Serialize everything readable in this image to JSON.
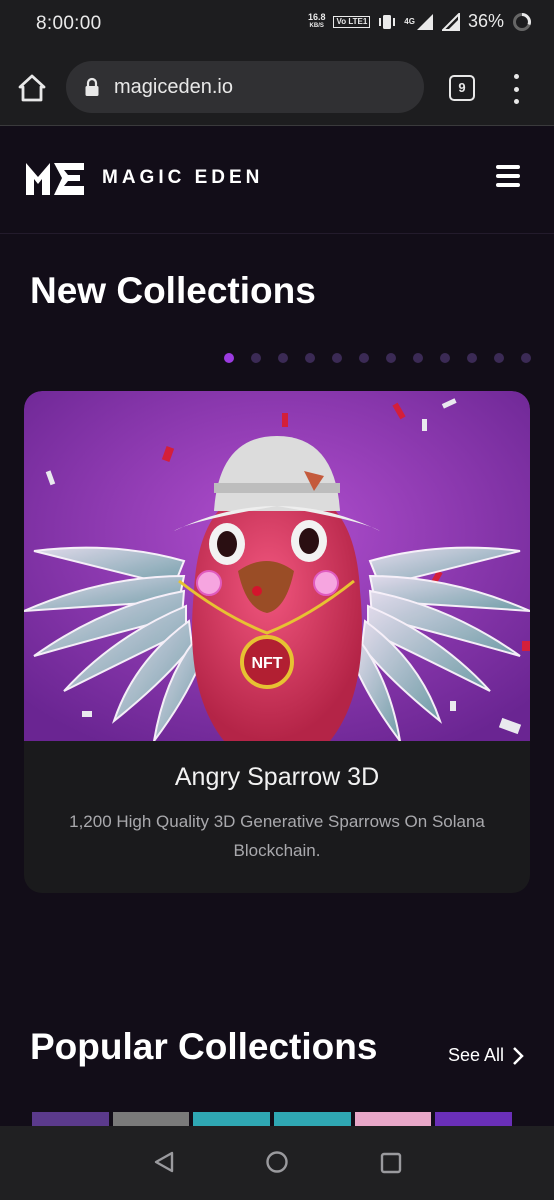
{
  "status_bar": {
    "time": "8:00:00",
    "net_speed_value": "16.8",
    "net_speed_unit": "KB/S",
    "volte_label": "Vo LTE1",
    "battery_percent": "36%",
    "network_type": "4G"
  },
  "browser": {
    "url": "magiceden.io",
    "tab_count": "9"
  },
  "site": {
    "brand_name": "MAGIC EDEN"
  },
  "new_collections": {
    "title": "New Collections",
    "carousel_dots_total": 12,
    "carousel_active_index": 0,
    "featured": {
      "name": "Angry Sparrow 3D",
      "description": "1,200 High Quality 3D Generative Sparrows On Solana Blockchain.",
      "badge_text": "NFT"
    }
  },
  "popular_collections": {
    "title": "Popular Collections",
    "see_all_label": "See All"
  },
  "colors": {
    "background": "#120d18",
    "accent_purple": "#9b3be0",
    "card_bg": "#1a1a1c"
  }
}
